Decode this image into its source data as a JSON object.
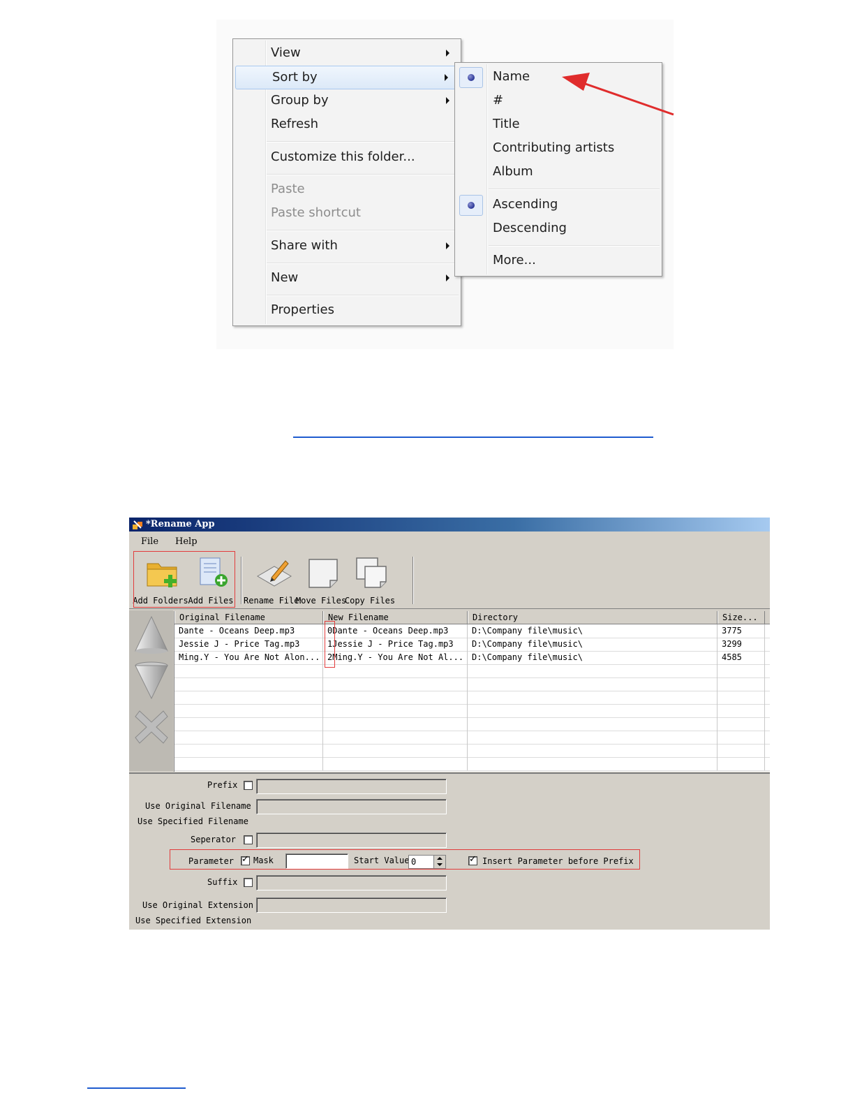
{
  "context_menu": {
    "main_items": [
      {
        "label": "View",
        "submenu": true
      },
      {
        "label": "Sort by",
        "submenu": true,
        "highlighted": true
      },
      {
        "label": "Group by",
        "submenu": true
      },
      {
        "label": "Refresh"
      },
      {
        "label": "Customize this folder..."
      },
      {
        "label": "Paste",
        "disabled": true
      },
      {
        "label": "Paste shortcut",
        "disabled": true
      },
      {
        "label": "Share with",
        "submenu": true
      },
      {
        "label": "New",
        "submenu": true
      },
      {
        "label": "Properties"
      }
    ],
    "sort_submenu": [
      {
        "label": "Name",
        "selected": true
      },
      {
        "label": "#"
      },
      {
        "label": "Title"
      },
      {
        "label": "Contributing artists"
      },
      {
        "label": "Album"
      },
      {
        "label": "Ascending",
        "selected": true
      },
      {
        "label": "Descending"
      },
      {
        "label": "More..."
      }
    ],
    "annotation_color": "#e02c2c",
    "radio_icon": "radio-dot-icon"
  },
  "app": {
    "title": "*Rename App",
    "menu": [
      "File",
      "Help"
    ],
    "toolbar": [
      {
        "label": "Add Folders",
        "icon": "folder-add-icon"
      },
      {
        "label": "Add Files",
        "icon": "file-add-icon"
      },
      {
        "label": "Rename Files",
        "icon": "rename-pen-icon"
      },
      {
        "label": "Move Files",
        "icon": "move-page-icon"
      },
      {
        "label": "Copy Files",
        "icon": "copy-pages-icon"
      }
    ],
    "side_buttons": [
      "move-up-icon",
      "move-down-icon",
      "delete-x-icon"
    ],
    "table": {
      "columns": [
        "Original Filename",
        "New Filename",
        "Directory",
        "Size..."
      ],
      "rows": [
        [
          "Dante - Oceans Deep.mp3",
          "0Dante - Oceans Deep.mp3",
          "D:\\Company file\\music\\",
          "3775"
        ],
        [
          "Jessie J - Price Tag.mp3",
          "1Jessie J - Price Tag.mp3",
          "D:\\Company file\\music\\",
          "3299"
        ],
        [
          "Ming.Y - You Are Not Alon...",
          "2Ming.Y - You Are Not Al...",
          "D:\\Company file\\music\\",
          "4585"
        ]
      ]
    },
    "form": {
      "prefix": "Prefix",
      "use_original_filename": "Use Original Filename",
      "use_specified_filename": "Use Specified Filename",
      "separator": "Seperator",
      "parameter": "Parameter",
      "mask": "Mask",
      "start_value": "Start Value",
      "start_value_input": "0",
      "insert_before_prefix": "Insert Parameter before Prefix",
      "suffix": "Suffix",
      "use_original_extension": "Use Original Extension",
      "use_specified_extension": "Use Specified Extension"
    },
    "highlight_color": "#e23c3c",
    "title_gradient": [
      "#0a246a",
      "#a6caf0"
    ]
  }
}
